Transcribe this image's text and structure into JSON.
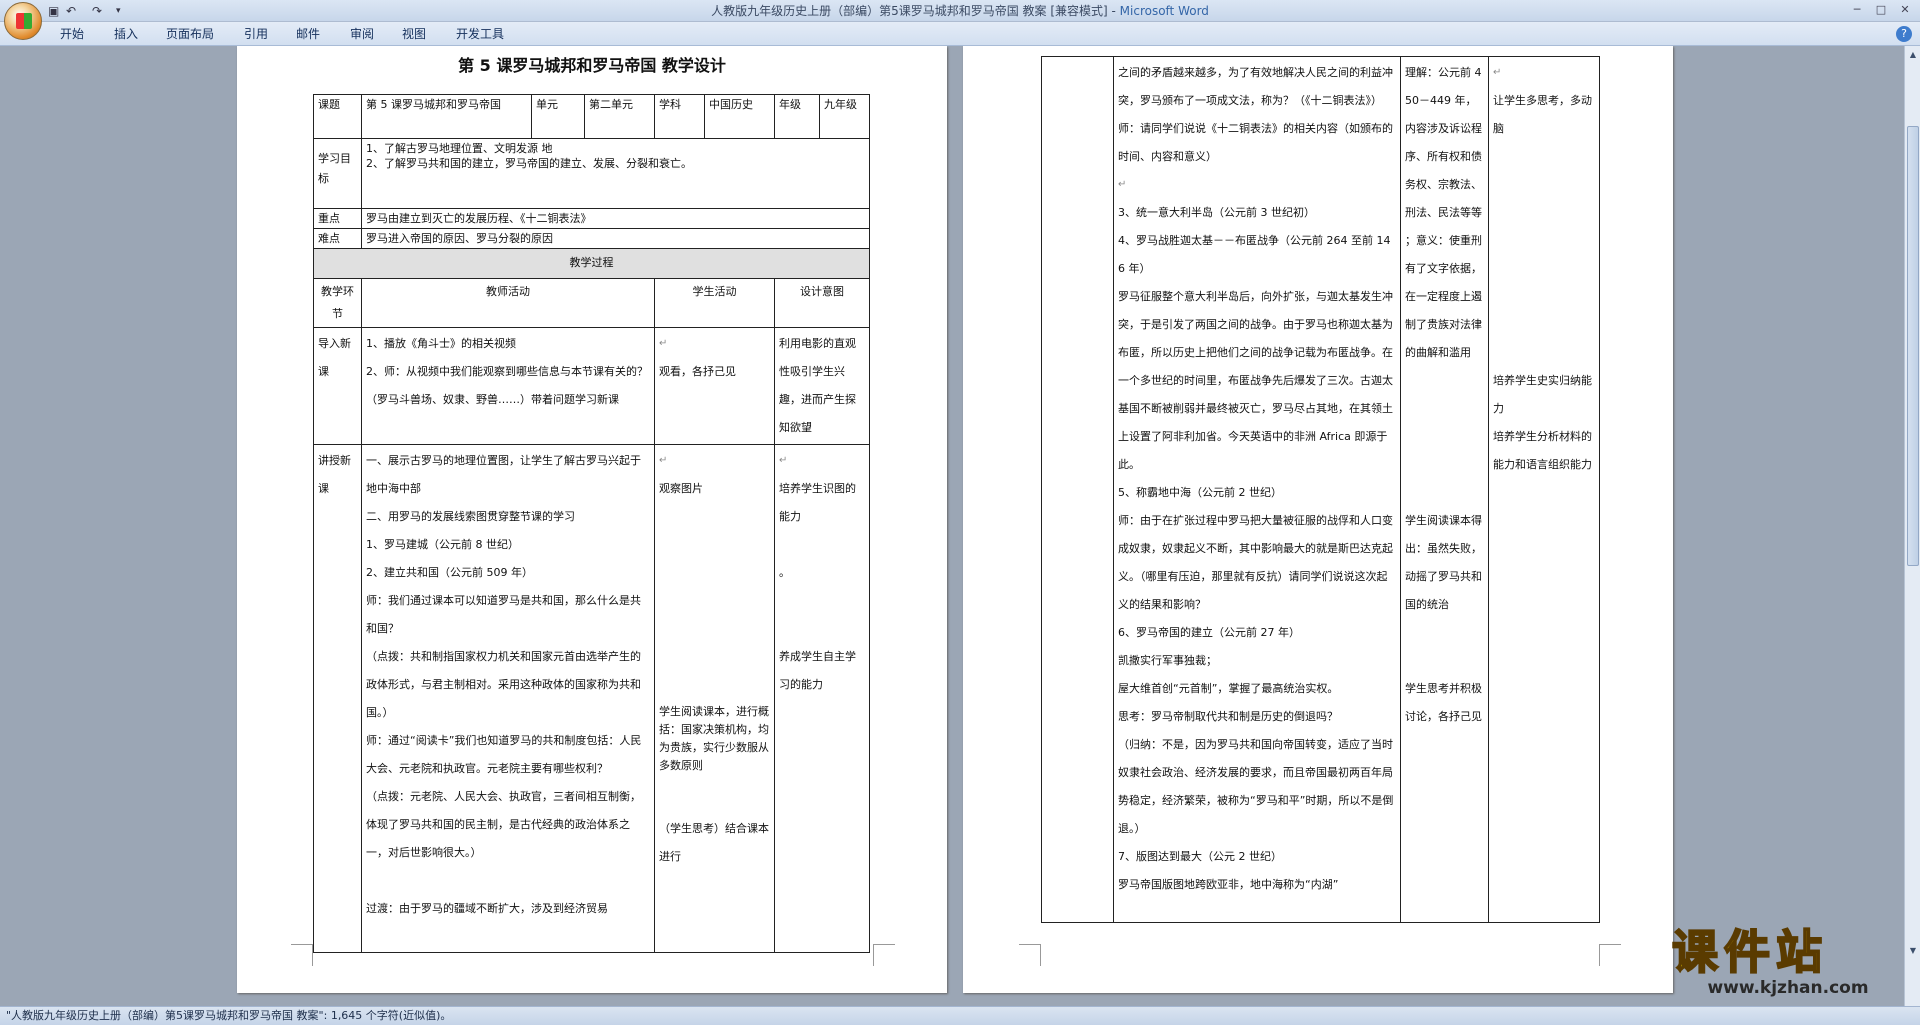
{
  "window": {
    "title": "人教版九年级历史上册（部编）第5课罗马城邦和罗马帝国 教案 [兼容模式] - ",
    "app": "Microsoft Word",
    "qat_undo": "↶",
    "qat_redo": "↷",
    "min": "─",
    "max": "□",
    "close": "✕"
  },
  "ribbon": {
    "tabs": [
      "开始",
      "插入",
      "页面布局",
      "引用",
      "邮件",
      "审阅",
      "视图",
      "开发工具"
    ],
    "help": "?"
  },
  "status": {
    "text": "\"人教版九年级历史上册（部编）第5课罗马城邦和罗马帝国 教案\": 1,645 个字符(近似值)。"
  },
  "watermark": {
    "big": "课件站",
    "url": "www.kjzhan.com"
  },
  "mark": "↵",
  "page1": {
    "title": "第 5 课罗马城邦和罗马帝国  教学设计",
    "header": {
      "k1": "课题",
      "v1": "第 5 课罗马城邦和罗马帝国",
      "k2": "单元",
      "v2": "第二单元",
      "k3": "学科",
      "v3": "中国历史",
      "k4": "年级",
      "v4": "九年级"
    },
    "goals": {
      "label": "学习目标",
      "items": [
        "1、了解古罗马地理位置、文明发源 地",
        "2、了解罗马共和国的建立，罗马帝国的建立、发展、分裂和衰亡。"
      ]
    },
    "key": {
      "label": "重点",
      "text": "罗马由建立到灭亡的发展历程、《十二铜表法》"
    },
    "diff": {
      "label": "难点",
      "text": "罗马进入帝国的原因、罗马分裂的原因"
    },
    "process": "教学过程",
    "cols": [
      "教学环节",
      "教师活动",
      "学生活动",
      "设计意图"
    ],
    "row1": {
      "stage": "导入新课",
      "teacher": [
        "1、播放《角斗士》的相关视频",
        "2、师：从视频中我们能观察到哪些信息与本节课有关的？（罗马斗兽场、奴隶、野兽……）带着问题学习新课"
      ],
      "student": "观看，各抒己见",
      "intent": "利用电影的直观性吸引学生兴趣，进而产生探知欲望"
    },
    "row2": {
      "stage": "讲授新课",
      "teacher": [
        "一、展示古罗马的地理位置图，让学生了解古罗马兴起于地中海中部",
        "二、用罗马的发展线索图贯穿整节课的学习",
        "1、罗马建城（公元前 8 世纪）",
        "2、建立共和国（公元前 509 年）",
        "师：我们通过课本可以知道罗马是共和国，那么什么是共和国？",
        "（点拨：共和制指国家权力机关和国家元首由选举产生的政体形式，与君主制相对。采用这种政体的国家称为共和国。）",
        "师：通过“阅读卡”我们也知道罗马的共和制度包括：人民大会、元老院和执政官。元老院主要有哪些权利？",
        "（点拨：元老院、人民大会、执政官，三者间相互制衡，体现了罗马共和国的民主制，是古代经典的政治体系之一，对后世影响很大。）",
        "过渡：由于罗马的疆域不断扩大，涉及到经济贸易"
      ],
      "student": [
        "观察图片",
        "学生阅读课本，进行概括：国家决策机构，均为贵族，实行少数服从多数原则",
        "（学生思考）结合课本进行"
      ],
      "intent": [
        "培养学生识图的能力",
        "。",
        "养成学生自主学习的能力"
      ]
    }
  },
  "page2": {
    "teacher": [
      "之间的矛盾越来越多，为了有效地解决人民之间的利益冲突，罗马颁布了一项成文法，称为？（《十二铜表法》）",
      "师：请同学们说说《十二铜表法》的相关内容（如颁布的时间、内容和意义）",
      "3、统一意大利半岛（公元前 3 世纪初）",
      "4、罗马战胜迦太基－－布匿战争（公元前 264 至前 146 年）",
      "罗马征服整个意大利半岛后，向外扩张，与迦太基发生冲突，于是引发了两国之间的战争。由于罗马也称迦太基为布匿，所以历史上把他们之间的战争记载为布匿战争。在一个多世纪的时间里，布匿战争先后爆发了三次。古迦太基国不断被削弱并最终被灭亡，罗马尽占其地，在其领土上设置了阿非利加省。今天英语中的非洲 Africa 即源于此。",
      "5、称霸地中海（公元前 2 世纪）",
      "师：由于在扩张过程中罗马把大量被征服的战俘和人口变成奴隶，奴隶起义不断，其中影响最大的就是斯巴达克起义。（哪里有压迫，那里就有反抗）请同学们说说这次起义的结果和影响？",
      "6、罗马帝国的建立（公元前 27 年）",
      "凯撒实行军事独裁；",
      "屋大维首创“元首制”，掌握了最高统治实权。",
      "思考：罗马帝制取代共和制是历史的倒退吗？",
      "（归纳：不是，因为罗马共和国向帝国转变，适应了当时奴隶社会政治、经济发展的要求，而且帝国最初两百年局势稳定，经济繁荣，被称为“罗马和平”时期，所以不是倒退。）",
      "7、版图达到最大（公元 2 世纪）",
      "罗马帝国版图地跨欧亚非，地中海称为“内湖”"
    ],
    "student": [
      "理解：公元前 450－449 年，内容涉及诉讼程序、所有权和债务权、宗教法、刑法、民法等等 ；意义：使重刑有了文字依据，在一定程度上遏制了贵族对法律的曲解和滥用",
      "学生阅读课本得出：虽然失败，动摇了罗马共和国的统治",
      "学生思考并积极讨论，各抒己见"
    ],
    "intent": [
      "让学生多思考，多动脑",
      "培养学生史实归纳能力",
      "培养学生分析材料的能力和语言组织能力"
    ]
  }
}
